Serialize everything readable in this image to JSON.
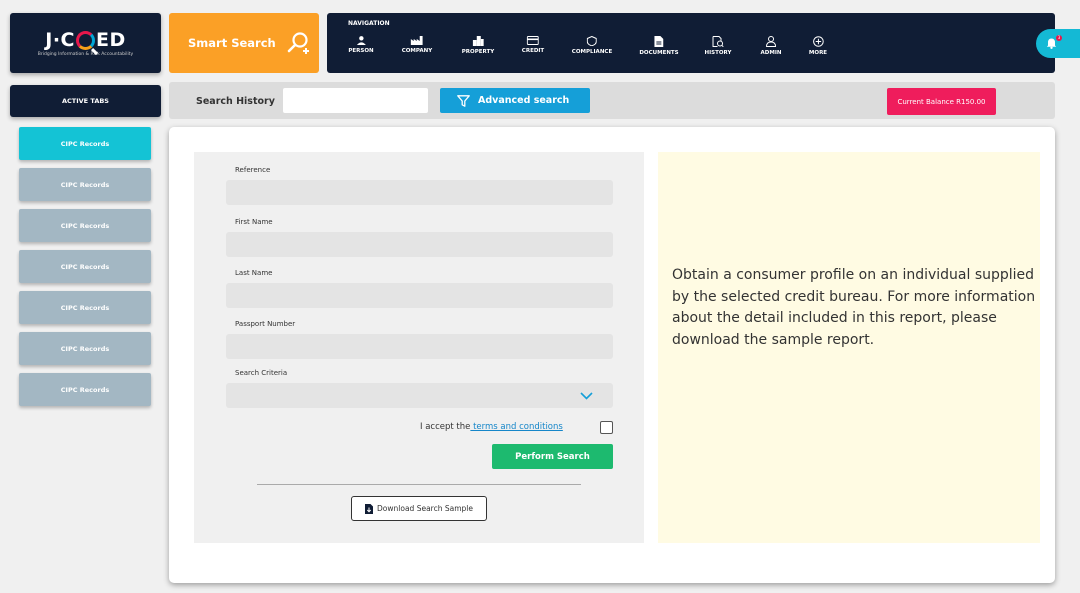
{
  "logo": {
    "name": "J·CRED",
    "tagline": "Bridging Information & Risk Accountability"
  },
  "smart_search": {
    "label": "Smart Search",
    "icon": "search-plus-icon"
  },
  "navigation": {
    "title": "NAVIGATION",
    "items": [
      {
        "label": "PERSON",
        "icon": "person-icon"
      },
      {
        "label": "COMPANY",
        "icon": "factory-icon"
      },
      {
        "label": "PROPERTY",
        "icon": "building-icon"
      },
      {
        "label": "CREDIT",
        "icon": "credit-card-icon"
      },
      {
        "label": "COMPLIANCE",
        "icon": "shield-icon"
      },
      {
        "label": "DOCUMENTS",
        "icon": "document-icon"
      },
      {
        "label": "HISTORY",
        "icon": "history-icon"
      },
      {
        "label": "ADMIN",
        "icon": "admin-icon"
      },
      {
        "label": "MORE",
        "icon": "plus-circle-icon"
      }
    ]
  },
  "notifications": {
    "count": "3"
  },
  "sidebar": {
    "title": "ACTIVE TABS",
    "tabs": [
      {
        "label": "CIPC Records",
        "active": true
      },
      {
        "label": "CIPC Records",
        "active": false
      },
      {
        "label": "CIPC Records",
        "active": false
      },
      {
        "label": "CIPC Records",
        "active": false
      },
      {
        "label": "CIPC Records",
        "active": false
      },
      {
        "label": "CIPC Records",
        "active": false
      },
      {
        "label": "CIPC Records",
        "active": false
      }
    ]
  },
  "search_bar": {
    "history_label": "Search History",
    "history_value": "",
    "advanced_label": "Advanced search",
    "balance_label": "Current Balance R150.00"
  },
  "form": {
    "fields": [
      {
        "label": "Reference",
        "value": ""
      },
      {
        "label": "First Name",
        "value": ""
      },
      {
        "label": "Last Name",
        "value": ""
      },
      {
        "label": "Passport Number",
        "value": ""
      },
      {
        "label": "Search Criteria",
        "value": ""
      }
    ],
    "terms_prefix": "I accept the",
    "terms_link": " terms and conditions",
    "submit_label": "Perform Search",
    "download_label": "Download  Search Sample"
  },
  "info": {
    "text": "Obtain a consumer profile on an individual supplied by the selected credit bureau. For more information about the detail included in this report, please download the sample report."
  },
  "colors": {
    "navy": "#101d35",
    "orange": "#fba026",
    "cyan": "#14c3d5",
    "blue": "#159fd8",
    "pink": "#ef1d5c",
    "green": "#1dba6f",
    "cream": "#fffbe3"
  }
}
